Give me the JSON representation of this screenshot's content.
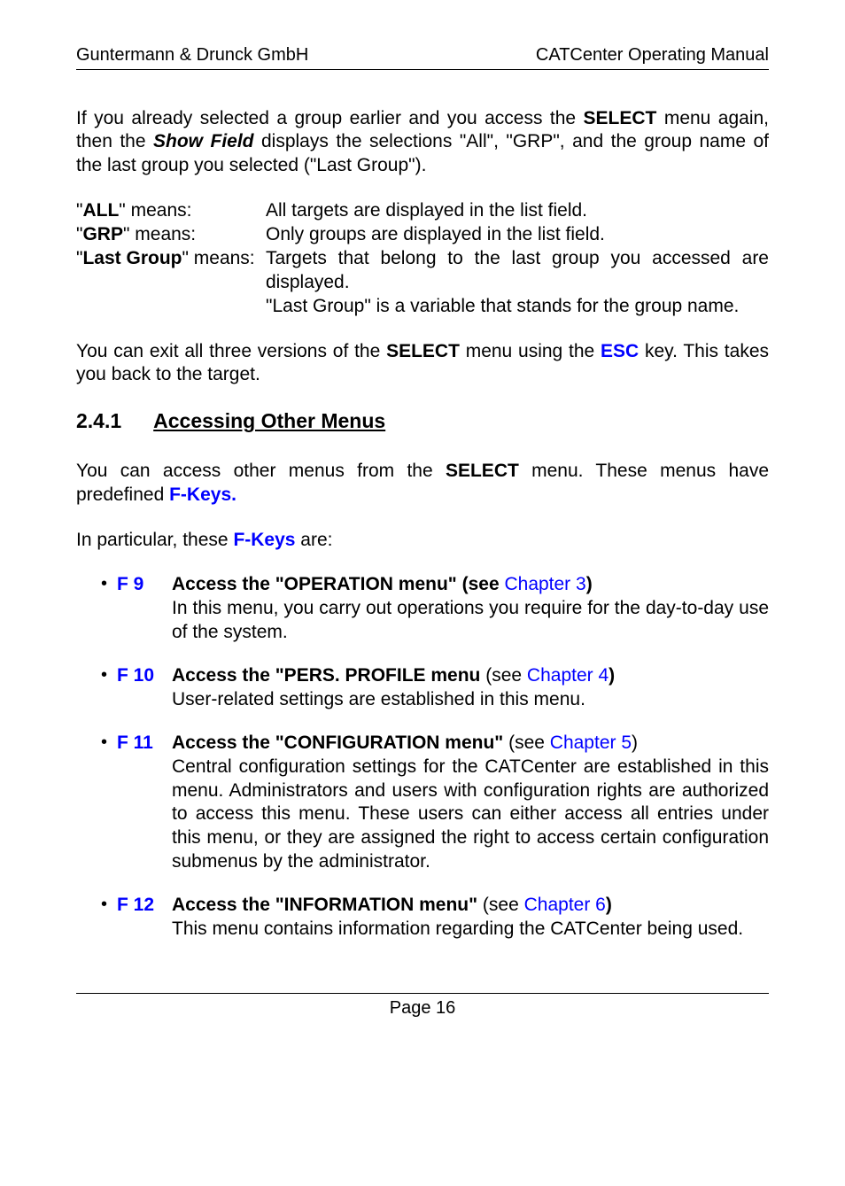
{
  "header": {
    "left": "Guntermann & Drunck GmbH",
    "right": "CATCenter Operating Manual"
  },
  "intro_para": {
    "t1": "If you already selected a group earlier and you access the ",
    "select": "SELECT",
    "t2": " menu again, then the ",
    "showfield": "Show Field",
    "t3": " displays the selections \"All\", \"GRP\", and the group name of the last group you selected (\"Last Group\")."
  },
  "defs": {
    "all": {
      "term_q1": "\"",
      "term_b": "ALL",
      "term_q2": "\" means:",
      "desc": "All targets are displayed in the list field."
    },
    "grp": {
      "term_q1": "\"",
      "term_b": "GRP",
      "term_q2": "\" means:",
      "desc": "Only groups are displayed in the list field."
    },
    "last": {
      "term_q1": "\"",
      "term_b": "Last Group",
      "term_q2": "\" means:",
      "desc1": "Targets that belong to the last group you accessed are displayed.",
      "desc2": "\"Last Group\" is a variable that stands for the group name."
    }
  },
  "exit_para": {
    "t1": "You can exit all three versions of the ",
    "select": "SELECT",
    "t2": " menu using the ",
    "esc": "ESC",
    "t3": " key.  This takes you back to the target."
  },
  "section": {
    "num": "2.4.1",
    "title": "Accessing Other Menus"
  },
  "access_para": {
    "t1": "You can access other menus from the ",
    "select": "SELECT",
    "t2": " menu.  These menus have predefined ",
    "fkeys": "F-Keys."
  },
  "in_particular": {
    "t1": "In particular, these ",
    "fkeys": "F-Keys",
    "t2": " are:"
  },
  "items": [
    {
      "fkey": "F 9",
      "title_b": "Access the \"OPERATION menu\" (see ",
      "title_link": "Chapter 3",
      "title_after": ")",
      "body": "In this menu, you carry out operations you require for the day-to-day use of the system."
    },
    {
      "fkey": "F 10",
      "title_b": "Access the \"PERS. PROFILE menu ",
      "title_see": "(see ",
      "title_link": "Chapter 4",
      "title_after": ")",
      "body": "User-related settings are established in this menu."
    },
    {
      "fkey": "F 11",
      "title_b": "Access the \"CONFIGURATION menu\" ",
      "title_see": "(see ",
      "title_link": "Chapter 5",
      "title_after": ")",
      "body": "Central configuration settings for the CATCenter are established in this menu.  Administrators and users with configuration rights are authorized to access this menu.  These users can either access all entries under this menu, or they are assigned the right to access certain configuration submenus by the administrator."
    },
    {
      "fkey": "F 12",
      "title_b": "Access the \"INFORMATION menu\" ",
      "title_see": "(see ",
      "title_link": "Chapter 6",
      "title_after": ")",
      "body": "This menu contains information regarding the CATCenter being used."
    }
  ],
  "footer": "Page 16"
}
